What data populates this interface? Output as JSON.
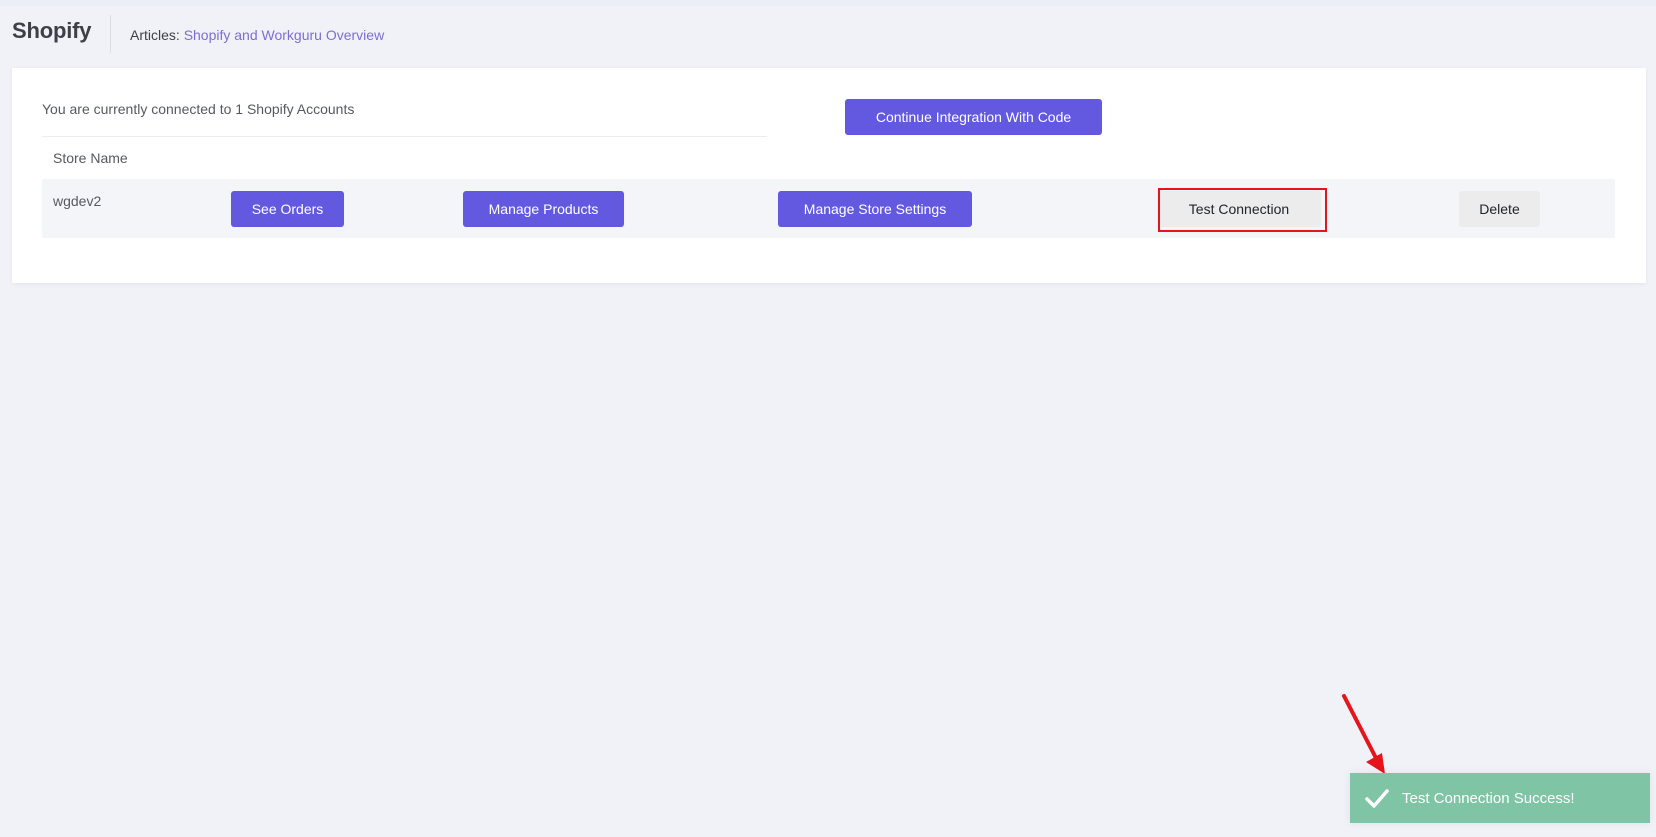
{
  "header": {
    "title": "Shopify",
    "articles_prefix": "Articles:",
    "articles_link": "Shopify and Workguru Overview"
  },
  "card": {
    "connected_text": "You are currently connected to 1 Shopify Accounts",
    "continue_button": "Continue Integration With Code",
    "table": {
      "column_store_name": "Store Name",
      "rows": [
        {
          "store_name": "wgdev2",
          "see_orders": "See Orders",
          "manage_products": "Manage Products",
          "manage_store_settings": "Manage Store Settings",
          "test_connection": "Test Connection",
          "delete": "Delete"
        }
      ]
    }
  },
  "toast": {
    "message": "Test Connection Success!",
    "icon": "check-icon"
  },
  "annotations": {
    "highlight_color": "#e4161c",
    "arrow_color": "#e4161c"
  },
  "colors": {
    "primary": "#6259e0",
    "link": "#7b6fd6",
    "toast_success": "#7fc4a4",
    "background": "#f1f2f8"
  }
}
